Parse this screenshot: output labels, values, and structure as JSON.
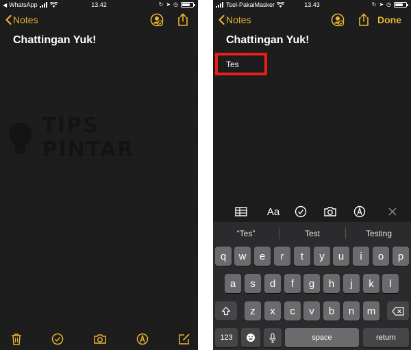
{
  "left_screen": {
    "status": {
      "carrier": "WhatsApp",
      "time": "13.42"
    },
    "nav": {
      "back_label": "Notes"
    },
    "note_title": "Chattingan Yuk!",
    "watermark": "TIPS PINTAR"
  },
  "right_screen": {
    "status": {
      "carrier": "Tsel-PakaiMasker",
      "time": "13.43"
    },
    "nav": {
      "back_label": "Notes",
      "done_label": "Done"
    },
    "note_title": "Chattingan Yuk!",
    "body_text": "Tes",
    "suggestions": [
      "“Tes”",
      "Test",
      "Testing"
    ],
    "keyboard": {
      "row1": [
        "q",
        "w",
        "e",
        "r",
        "t",
        "y",
        "u",
        "i",
        "o",
        "p"
      ],
      "row2": [
        "a",
        "s",
        "d",
        "f",
        "g",
        "h",
        "j",
        "k",
        "l"
      ],
      "row3": [
        "z",
        "x",
        "c",
        "v",
        "b",
        "n",
        "m"
      ],
      "numbers_label": "123",
      "space_label": "space",
      "return_label": "return"
    }
  },
  "accent_color": "#e7b52c",
  "highlight_color": "#ea1c1c",
  "icons": [
    "signal-icon",
    "wifi-icon",
    "lock-rotation-icon",
    "location-icon",
    "alarm-icon",
    "battery-icon",
    "share-person-icon",
    "share-icon",
    "trash-icon",
    "checklist-icon",
    "camera-icon",
    "markup-icon",
    "compose-icon",
    "table-icon",
    "text-format-icon",
    "close-icon",
    "shift-icon",
    "backspace-icon",
    "emoji-icon",
    "microphone-icon"
  ]
}
